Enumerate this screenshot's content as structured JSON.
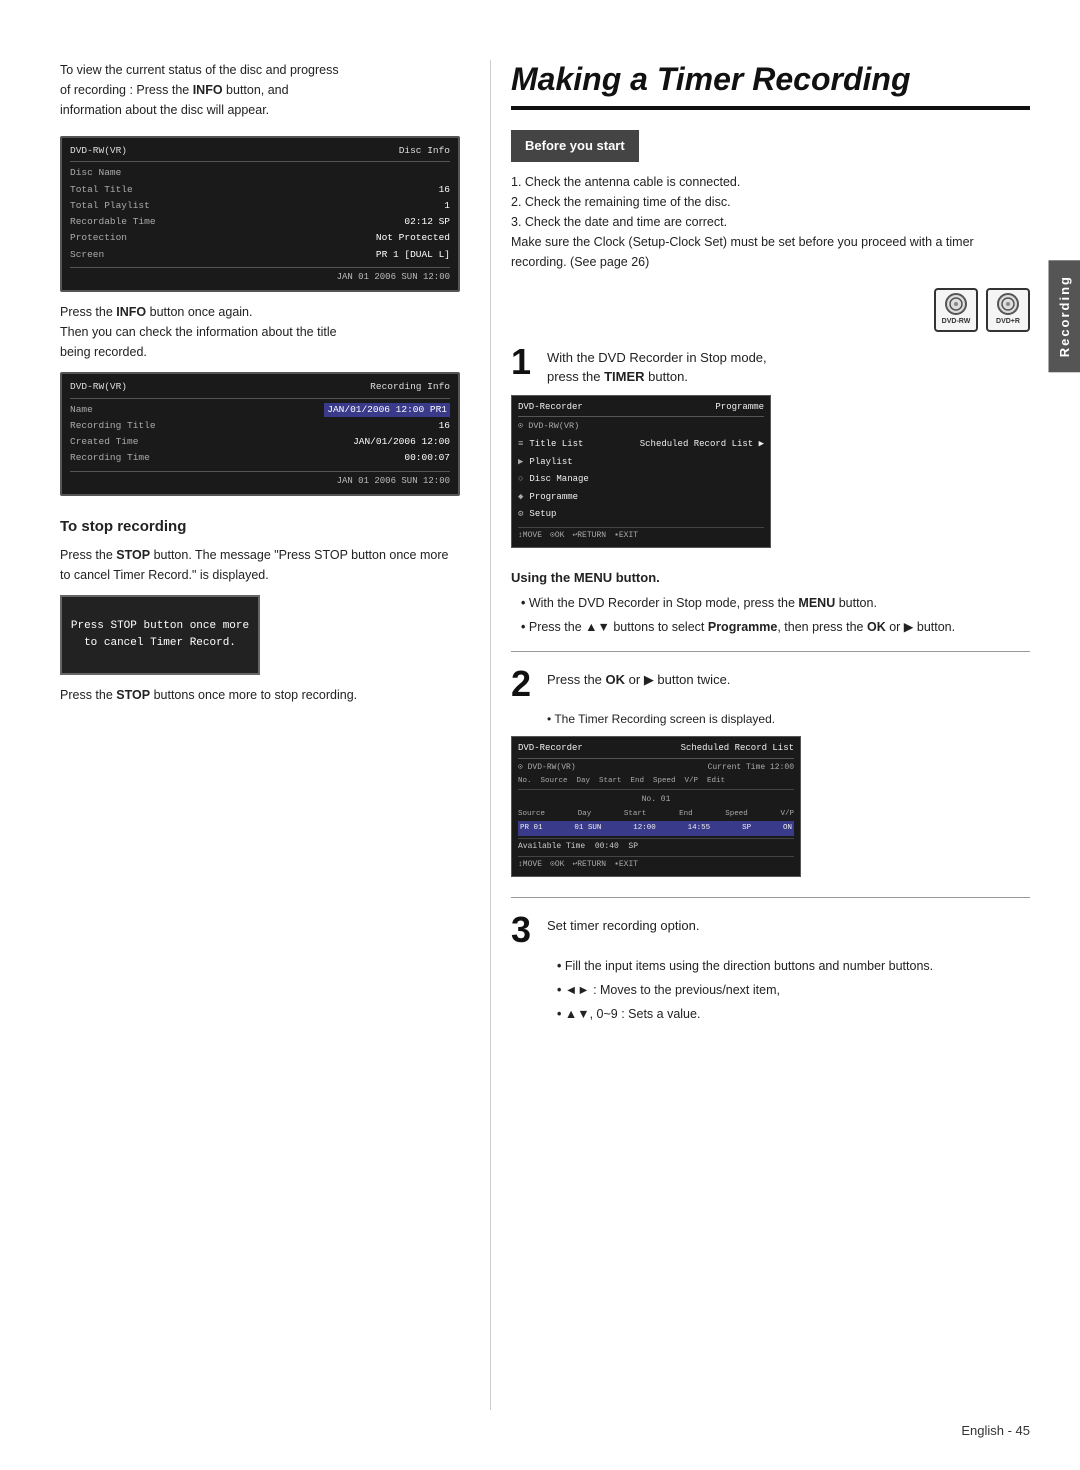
{
  "page": {
    "title": "Making a Timer Recording",
    "footer": "English - 45",
    "side_tab": "Recording"
  },
  "left": {
    "top_para": {
      "line1": "To view the current status of the disc and progress",
      "line2": "of recording : Press the",
      "bold1": "INFO",
      "line3": "button, and",
      "line4": "information about the disc will appear."
    },
    "disc_info_screen": {
      "title_left": "DVD-RW(VR)",
      "title_right": "Disc Info",
      "disc_name_label": "Disc Name",
      "disc_name_val": "",
      "rows": [
        {
          "label": "Total Title",
          "val": "16"
        },
        {
          "label": "Total Playlist",
          "val": "1"
        },
        {
          "label": "Recordable Time",
          "val": "02:12 SP"
        },
        {
          "label": "Protection",
          "val": "Not Protected"
        },
        {
          "label": "Screen",
          "val": "PR 1 [DUAL L]"
        }
      ],
      "footer": "JAN 01 2006 SUN              12:00"
    },
    "para2_line1": "Press the",
    "para2_bold": "INFO",
    "para2_line2": "button once again.",
    "para2_line3": "Then you can check the information about the title",
    "para2_line4": "being recorded.",
    "recording_info_screen": {
      "title_left": "DVD-RW(VR)",
      "title_right": "Recording Info",
      "rows": [
        {
          "label": "Name",
          "val": "JAN/01/2006 12:00 PR1"
        },
        {
          "label": "Recording Title",
          "val": "16"
        },
        {
          "label": "Created Time",
          "val": "JAN/01/2006 12:00"
        },
        {
          "label": "Recording Time",
          "val": "00:00:07"
        }
      ],
      "footer": "JAN 01 2006 SUN              12:00"
    },
    "to_stop": {
      "heading": "To stop recording",
      "para1": "Press the",
      "para1_bold": "STOP",
      "para1_rest": "button. The message \"Press STOP button once more to cancel Timer Record.\" is displayed.",
      "stop_screen_text": "Press STOP button once more\nto cancel Timer Record.",
      "para2_pre": "Press the",
      "para2_bold": "STOP",
      "para2_rest": "buttons once more to stop recording."
    }
  },
  "right": {
    "before_you_start": {
      "label": "Before you start",
      "items": [
        "Check the antenna cable is connected.",
        "Check the remaining time of the disc.",
        "Check the date and time are correct."
      ],
      "note": "Make sure the Clock (Setup-Clock Set) must be set before you proceed with a timer recording. (See page 26)"
    },
    "dvd_icons": [
      {
        "label": "DVD-RW"
      },
      {
        "label": "DVD+R"
      }
    ],
    "step1": {
      "num": "1",
      "text1": "With the DVD Recorder in Stop mode,",
      "text2": "press the",
      "text2_bold": "TIMER",
      "text2_rest": "button.",
      "prog_screen": {
        "title_left": "DVD-Recorder",
        "title_right": "Programme",
        "sub_left": "DVD-RW(VR)",
        "items": [
          {
            "icon": "≡",
            "label": "Title List",
            "extra": "Scheduled Record List",
            "selected": true
          },
          {
            "icon": "▶",
            "label": "Playlist",
            "selected": false
          },
          {
            "icon": "○",
            "label": "Disc Manage",
            "selected": false
          },
          {
            "icon": "◆",
            "label": "Programme",
            "selected": false
          },
          {
            "icon": "⚙",
            "label": "Setup",
            "selected": false
          }
        ],
        "nav": [
          "MOVE",
          "OK",
          "RETURN",
          "EXIT"
        ]
      }
    },
    "using_menu": {
      "heading": "Using the MENU button.",
      "bullets": [
        {
          "pre": "With the DVD Recorder in Stop mode, press the",
          "bold": "MENU",
          "post": "button."
        },
        {
          "pre": "Press the ▲▼ buttons to select",
          "bold": "Programme",
          "post": ", then press the",
          "bold2": "OK",
          "post2": "or ▶ button."
        }
      ]
    },
    "step2": {
      "num": "2",
      "text1": "Press the",
      "text1_bold": "OK",
      "text1_rest": "or ▶ button twice.",
      "bullet": "• The Timer Recording screen is displayed.",
      "timer_screen": {
        "title_left": "DVD-Recorder",
        "title_right": "Scheduled Record List",
        "sub_left": "DVD-RW(VR)",
        "sub_right": "Current Time 12:00",
        "col_headers": "No.  Source  Day  Start  End  Speed  V/P  Edit",
        "no_text": "No. 01",
        "data_cols": [
          "Source",
          "Day",
          "Start",
          "End",
          "Speed",
          "V/P"
        ],
        "data_row": [
          "PR 01",
          "01 SUN",
          "12:00",
          "14:55",
          "SP",
          "ON"
        ],
        "avail": "Available Time  00:40  SP",
        "nav": [
          "MOVE",
          "OK",
          "RETURN",
          "EXIT"
        ]
      }
    },
    "step3": {
      "num": "3",
      "text": "Set timer recording option.",
      "bullets": [
        "Fill the input items using the direction buttons and number buttons.",
        "◄► : Moves to the previous/next item,",
        "▲▼, 0~9 : Sets a value."
      ]
    }
  }
}
